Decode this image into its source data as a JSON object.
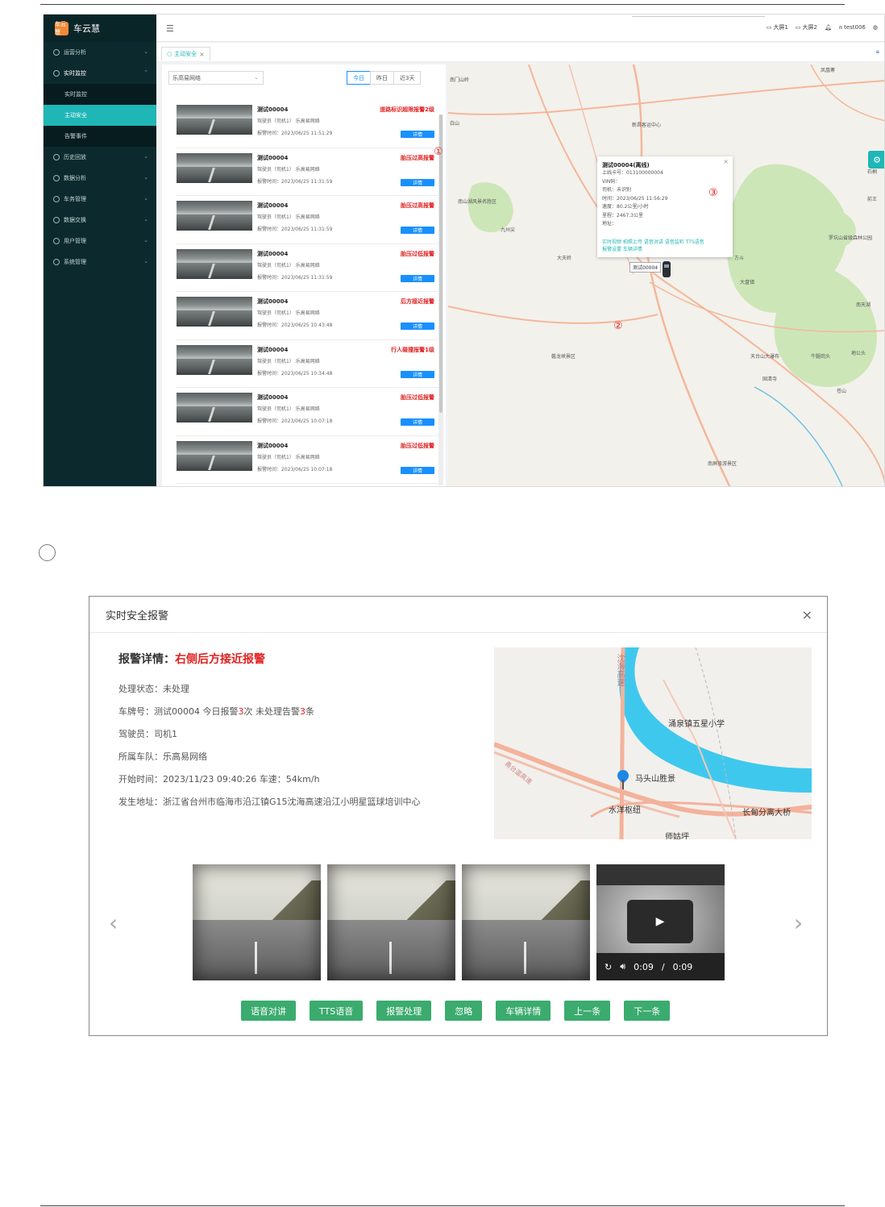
{
  "brand": {
    "name": "车云慧",
    "logo_text": "车云慧"
  },
  "sidebar": {
    "items": [
      {
        "label": "运营分析"
      },
      {
        "label": "实时监控"
      },
      {
        "label": "历史回放"
      },
      {
        "label": "数据分析"
      },
      {
        "label": "车务管理"
      },
      {
        "label": "数据交换"
      },
      {
        "label": "用户管理"
      },
      {
        "label": "系统管理"
      }
    ],
    "submenu": [
      {
        "label": "实时监控"
      },
      {
        "label": "主动安全"
      },
      {
        "label": "告警事件"
      }
    ]
  },
  "header": {
    "screen1": "大屏1",
    "screen2": "大屏2",
    "user": "test006"
  },
  "tab": {
    "label": "主动安全"
  },
  "filter": {
    "fleet": "乐高易网络"
  },
  "range_tabs": [
    "今日",
    "昨日",
    "近3天"
  ],
  "markers": {
    "one": "①",
    "two": "②",
    "three": "③"
  },
  "alarms": [
    {
      "plate": "测试00004",
      "driver": "驾驶员（司机1） 乐高易网络",
      "time": "报警时间：2023/06/25 11:51:29",
      "type": "道路标识超限报警2级",
      "btn": "详情"
    },
    {
      "plate": "测试00004",
      "driver": "驾驶员（司机1） 乐高易网络",
      "time": "报警时间：2023/06/25 11:31:59",
      "type": "胎压过高报警",
      "btn": "详情"
    },
    {
      "plate": "测试00004",
      "driver": "驾驶员（司机1） 乐高易网络",
      "time": "报警时间：2023/06/25 11:31:59",
      "type": "胎压过高报警",
      "btn": "详情"
    },
    {
      "plate": "测试00004",
      "driver": "驾驶员（司机1） 乐高易网络",
      "time": "报警时间：2023/06/25 11:31:59",
      "type": "胎压过低报警",
      "btn": "详情"
    },
    {
      "plate": "测试00004",
      "driver": "驾驶员（司机1） 乐高易网络",
      "time": "报警时间：2023/06/25 10:43:48",
      "type": "后方接近报警",
      "btn": "详情"
    },
    {
      "plate": "测试00004",
      "driver": "驾驶员（司机1） 乐高易网络",
      "time": "报警时间：2023/06/25 10:34:48",
      "type": "行人碰撞报警1级",
      "btn": "详情"
    },
    {
      "plate": "测试00004",
      "driver": "驾驶员（司机1） 乐高易网络",
      "time": "报警时间：2023/06/25 10:07:18",
      "type": "胎压过低报警",
      "btn": "详情"
    },
    {
      "plate": "测试00004",
      "driver": "驾驶员（司机1） 乐高易网络",
      "time": "报警时间：2023/06/25 10:07:18",
      "type": "胎压过低报警",
      "btn": "详情"
    }
  ],
  "map1": {
    "labels": [
      "南门山岭",
      "白山",
      "新昌客运中心",
      "南山湖风景名胜区",
      "九州尖",
      "大天岭",
      "大盘镇",
      "石桐",
      "磐龙峡景区",
      "天台山大瀑布",
      "牛腿岗头",
      "地公头",
      "国清寺",
      "苍山",
      "南屏旅游景区",
      "罗坑山省级森林公园",
      "凤凰寨",
      "南天湖",
      "方斗",
      "前王"
    ],
    "car_tag": "测试00004"
  },
  "popup": {
    "title": "测试00004(离线)",
    "lines": [
      "上线卡号：013100000004",
      "VIN码：",
      "司机：未识别",
      "时间：2023/06/25 11:56:29",
      "速度：80.2公里/小时",
      "里程：2467.3公里",
      "地址："
    ],
    "links1": "实时视频 拍照上传 语音对讲 语音监听 TTS语音",
    "links2": "报警设置 车辆详情"
  },
  "dialog": {
    "title": "实时安全报警",
    "detail_label": "报警详情：",
    "detail_value": "右侧后方接近报警",
    "status": "处理状态：未处理",
    "plate_prefix": "车牌号：测试00004   今日报警",
    "today_count": "3",
    "plate_mid": "次   未处理告警",
    "pending_count": "3",
    "plate_suffix": "条",
    "driver": "驾驶员：司机1",
    "fleet": "所属车队：乐高易网络",
    "start": "开始时间：2023/11/23 09:40:26   车速：54km/h",
    "address": "发生地址：浙江省台州市临海市沿江镇G15沈海高速沿江小明星篮球培训中心",
    "map_labels": [
      "沈海高速",
      "涌泉镇五星小学",
      "马头山胜景",
      "水洋枢纽",
      "长甸分离大桥",
      "师姑坪",
      "甬台温高速"
    ],
    "video_time": "0:09",
    "video_sep": "/",
    "video_total": "0:09",
    "actions": [
      "语音对讲",
      "TTS语音",
      "报警处理",
      "忽略",
      "车辆详情",
      "上一条",
      "下一条"
    ]
  }
}
